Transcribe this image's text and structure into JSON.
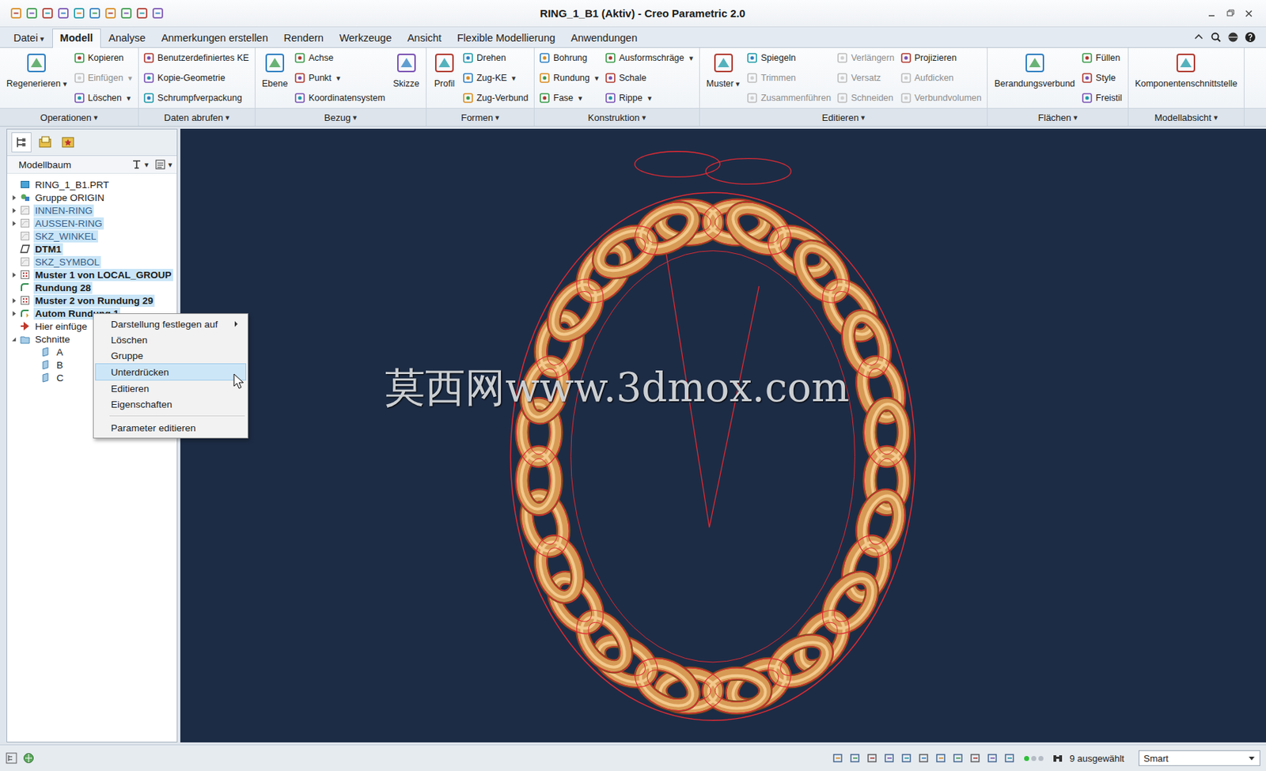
{
  "window": {
    "title": "RING_1_B1 (Aktiv) - Creo Parametric 2.0"
  },
  "dropdown_glyph": "▾",
  "menu_tabs": [
    {
      "label": "Datei",
      "dropdown": true,
      "selected": false
    },
    {
      "label": "Modell",
      "dropdown": false,
      "selected": true
    },
    {
      "label": "Analyse",
      "dropdown": false,
      "selected": false
    },
    {
      "label": "Anmerkungen erstellen",
      "dropdown": false,
      "selected": false
    },
    {
      "label": "Rendern",
      "dropdown": false,
      "selected": false
    },
    {
      "label": "Werkzeuge",
      "dropdown": false,
      "selected": false
    },
    {
      "label": "Ansicht",
      "dropdown": false,
      "selected": false
    },
    {
      "label": "Flexible Modellierung",
      "dropdown": false,
      "selected": false
    },
    {
      "label": "Anwendungen",
      "dropdown": false,
      "selected": false
    }
  ],
  "ribbon": {
    "groups": [
      {
        "label": "Operationen",
        "dropdown": true,
        "columns": [
          {
            "kind": "large",
            "items": [
              {
                "label": "Regenerieren",
                "dropdown": true,
                "disabled": false
              }
            ]
          },
          {
            "kind": "small",
            "items": [
              {
                "label": "Kopieren",
                "dropdown": false,
                "disabled": false
              },
              {
                "label": "Einfügen",
                "dropdown": true,
                "disabled": true
              },
              {
                "label": "Löschen",
                "dropdown": true,
                "disabled": false
              }
            ]
          }
        ]
      },
      {
        "label": "Daten abrufen",
        "dropdown": true,
        "columns": [
          {
            "kind": "small",
            "items": [
              {
                "label": "Benutzerdefiniertes KE",
                "dropdown": false,
                "disabled": false
              },
              {
                "label": "Kopie-Geometrie",
                "dropdown": false,
                "disabled": false
              },
              {
                "label": "Schrumpfverpackung",
                "dropdown": false,
                "disabled": false
              }
            ]
          }
        ]
      },
      {
        "label": "Bezug",
        "dropdown": true,
        "columns": [
          {
            "kind": "large",
            "items": [
              {
                "label": "Ebene",
                "dropdown": false,
                "disabled": false
              }
            ]
          },
          {
            "kind": "small",
            "items": [
              {
                "label": "Achse",
                "dropdown": false,
                "disabled": false
              },
              {
                "label": "Punkt",
                "dropdown": true,
                "disabled": false
              },
              {
                "label": "Koordinatensystem",
                "dropdown": false,
                "disabled": false
              }
            ]
          },
          {
            "kind": "large",
            "items": [
              {
                "label": "Skizze",
                "dropdown": false,
                "disabled": false
              }
            ]
          }
        ]
      },
      {
        "label": "Formen",
        "dropdown": true,
        "columns": [
          {
            "kind": "large",
            "items": [
              {
                "label": "Profil",
                "dropdown": false,
                "disabled": false
              }
            ]
          },
          {
            "kind": "small",
            "items": [
              {
                "label": "Drehen",
                "dropdown": false,
                "disabled": false
              },
              {
                "label": "Zug-KE",
                "dropdown": true,
                "disabled": false
              },
              {
                "label": "Zug-Verbund",
                "dropdown": false,
                "disabled": false
              }
            ]
          }
        ]
      },
      {
        "label": "Konstruktion",
        "dropdown": true,
        "columns": [
          {
            "kind": "small",
            "items": [
              {
                "label": "Bohrung",
                "dropdown": false,
                "disabled": false
              },
              {
                "label": "Rundung",
                "dropdown": true,
                "disabled": false
              },
              {
                "label": "Fase",
                "dropdown": true,
                "disabled": false
              }
            ]
          },
          {
            "kind": "small",
            "items": [
              {
                "label": "Ausformschräge",
                "dropdown": true,
                "disabled": false
              },
              {
                "label": "Schale",
                "dropdown": false,
                "disabled": false
              },
              {
                "label": "Rippe",
                "dropdown": true,
                "disabled": false
              }
            ]
          }
        ]
      },
      {
        "label": "Editieren",
        "dropdown": true,
        "columns": [
          {
            "kind": "large",
            "items": [
              {
                "label": "Muster",
                "dropdown": true,
                "disabled": false
              }
            ]
          },
          {
            "kind": "small",
            "items": [
              {
                "label": "Spiegeln",
                "dropdown": false,
                "disabled": false
              },
              {
                "label": "Trimmen",
                "dropdown": false,
                "disabled": true
              },
              {
                "label": "Zusammenführen",
                "dropdown": false,
                "disabled": true
              }
            ]
          },
          {
            "kind": "small",
            "items": [
              {
                "label": "Verlängern",
                "dropdown": false,
                "disabled": true
              },
              {
                "label": "Versatz",
                "dropdown": false,
                "disabled": true
              },
              {
                "label": "Schneiden",
                "dropdown": false,
                "disabled": true
              }
            ]
          },
          {
            "kind": "small",
            "items": [
              {
                "label": "Projizieren",
                "dropdown": false,
                "disabled": false
              },
              {
                "label": "Aufdicken",
                "dropdown": false,
                "disabled": true
              },
              {
                "label": "Verbundvolumen",
                "dropdown": false,
                "disabled": true
              }
            ]
          }
        ]
      },
      {
        "label": "Flächen",
        "dropdown": true,
        "columns": [
          {
            "kind": "large",
            "items": [
              {
                "label": "Berandungsverbund",
                "dropdown": false,
                "disabled": false
              }
            ]
          },
          {
            "kind": "small",
            "items": [
              {
                "label": "Füllen",
                "dropdown": false,
                "disabled": false
              },
              {
                "label": "Style",
                "dropdown": false,
                "disabled": false
              },
              {
                "label": "Freistil",
                "dropdown": false,
                "disabled": false
              }
            ]
          }
        ]
      },
      {
        "label": "Modellabsicht",
        "dropdown": true,
        "columns": [
          {
            "kind": "large",
            "items": [
              {
                "label": "Komponentenschnittstelle",
                "dropdown": false,
                "disabled": false
              }
            ]
          }
        ]
      }
    ]
  },
  "model_tree": {
    "title": "Modellbaum",
    "items": [
      {
        "label": "RING_1_B1.PRT",
        "kind": "part",
        "depth": 0,
        "has_children": false,
        "expanded": false,
        "selected": false,
        "hidden": false
      },
      {
        "label": "Gruppe ORIGIN",
        "kind": "group",
        "depth": 0,
        "has_children": true,
        "expanded": false,
        "selected": false,
        "hidden": false
      },
      {
        "label": "INNEN-RING",
        "kind": "sketch",
        "depth": 0,
        "has_children": true,
        "expanded": false,
        "selected": true,
        "hidden": true
      },
      {
        "label": "AUSSEN-RING",
        "kind": "sketch",
        "depth": 0,
        "has_children": true,
        "expanded": false,
        "selected": true,
        "hidden": true
      },
      {
        "label": "SKZ_WINKEL",
        "kind": "sketch",
        "depth": 0,
        "has_children": false,
        "expanded": false,
        "selected": true,
        "hidden": true
      },
      {
        "label": "DTM1",
        "kind": "datum",
        "depth": 0,
        "has_children": false,
        "expanded": false,
        "selected": true,
        "hidden": false
      },
      {
        "label": "SKZ_SYMBOL",
        "kind": "sketch",
        "depth": 0,
        "has_children": false,
        "expanded": false,
        "selected": true,
        "hidden": true
      },
      {
        "label": "Muster 1 von LOCAL_GROUP",
        "kind": "pattern",
        "depth": 0,
        "has_children": true,
        "expanded": false,
        "selected": true,
        "hidden": false
      },
      {
        "label": "Rundung 28",
        "kind": "round",
        "depth": 0,
        "has_children": false,
        "expanded": false,
        "selected": true,
        "hidden": false
      },
      {
        "label": "Muster 2 von Rundung 29",
        "kind": "pattern",
        "depth": 0,
        "has_children": true,
        "expanded": false,
        "selected": true,
        "hidden": false
      },
      {
        "label": "Autom Rundung 1",
        "kind": "autoround",
        "depth": 0,
        "has_children": true,
        "expanded": false,
        "selected": true,
        "hidden": false
      },
      {
        "label": "Hier einfüge",
        "kind": "insert",
        "depth": 0,
        "has_children": false,
        "expanded": false,
        "selected": false,
        "hidden": false
      },
      {
        "label": "Schnitte",
        "kind": "folder",
        "depth": 0,
        "has_children": true,
        "expanded": true,
        "selected": false,
        "hidden": false
      },
      {
        "label": "A",
        "kind": "section",
        "depth": 1,
        "has_children": false,
        "expanded": false,
        "selected": false,
        "hidden": false
      },
      {
        "label": "B",
        "kind": "section",
        "depth": 1,
        "has_children": false,
        "expanded": false,
        "selected": false,
        "hidden": false
      },
      {
        "label": "C",
        "kind": "section",
        "depth": 1,
        "has_children": false,
        "expanded": false,
        "selected": false,
        "hidden": false
      }
    ]
  },
  "context_menu": {
    "items": [
      {
        "kind": "item",
        "label": "Darstellung festlegen auf",
        "submenu": true,
        "selected": false
      },
      {
        "kind": "item",
        "label": "Löschen",
        "submenu": false,
        "selected": false
      },
      {
        "kind": "item",
        "label": "Gruppe",
        "submenu": false,
        "selected": false
      },
      {
        "kind": "item",
        "label": "Unterdrücken",
        "submenu": false,
        "selected": true
      },
      {
        "kind": "item",
        "label": "Editieren",
        "submenu": false,
        "selected": false
      },
      {
        "kind": "item",
        "label": "Eigenschaften",
        "submenu": false,
        "selected": false
      },
      {
        "kind": "separator",
        "label": "",
        "submenu": false,
        "selected": false
      },
      {
        "kind": "item",
        "label": "Parameter editieren",
        "submenu": false,
        "selected": false
      }
    ]
  },
  "viewport": {
    "watermark": "莫西网www.3dmox.com"
  },
  "status_bar": {
    "selection": "9 ausgewählt",
    "filter": "Smart"
  }
}
